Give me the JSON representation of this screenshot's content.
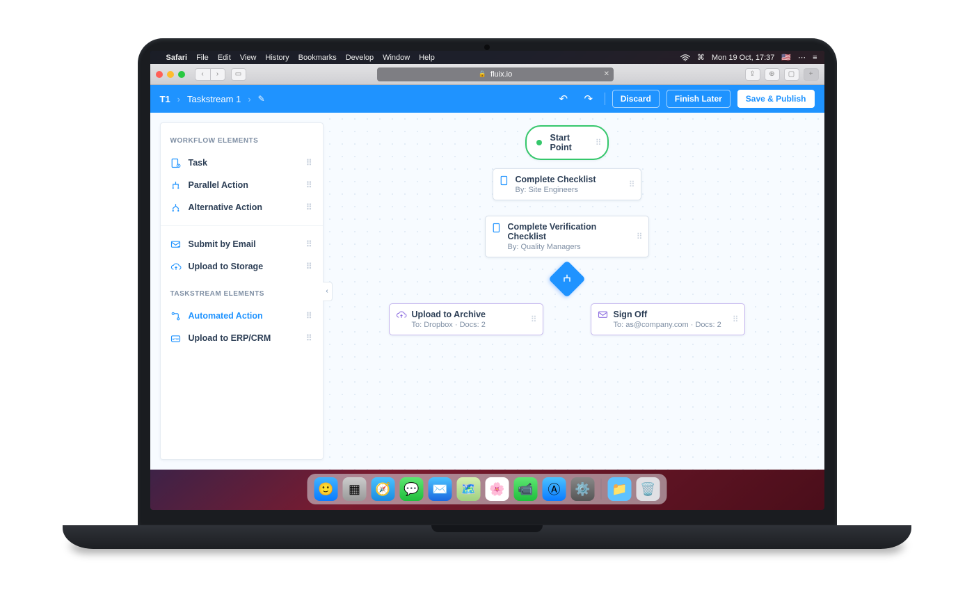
{
  "menubar": {
    "app": "Safari",
    "items": [
      "File",
      "Edit",
      "View",
      "History",
      "Bookmarks",
      "Develop",
      "Window",
      "Help"
    ],
    "clock": "Mon 19 Oct, 17:37"
  },
  "browser": {
    "url_host": "fluix.io"
  },
  "header": {
    "id": "T1",
    "title": "Taskstream 1",
    "discard": "Discard",
    "finish": "Finish Later",
    "publish": "Save & Publish"
  },
  "sidebar": {
    "section1_title": "WORKFLOW ELEMENTS",
    "section2_title": "TASKSTREAM ELEMENTS",
    "items1": [
      {
        "label": "Task"
      },
      {
        "label": "Parallel Action"
      },
      {
        "label": "Alternative Action"
      },
      {
        "label": "Submit by Email"
      },
      {
        "label": "Upload to Storage"
      }
    ],
    "items2": [
      {
        "label": "Automated Action",
        "active": true
      },
      {
        "label": "Upload to ERP/CRM"
      }
    ]
  },
  "flow": {
    "start": "Start Point",
    "n1_title": "Complete Checklist",
    "n1_sub": "By: Site Engineers",
    "n2_title": "Complete Verification Checklist",
    "n2_sub": "By: Quality Managers",
    "n3_title": "Upload to Archive",
    "n3_sub": "To: Dropbox  ·  Docs: 2",
    "n4_title": "Sign Off",
    "n4_sub": "To: as@company.com  ·  Docs: 2"
  }
}
